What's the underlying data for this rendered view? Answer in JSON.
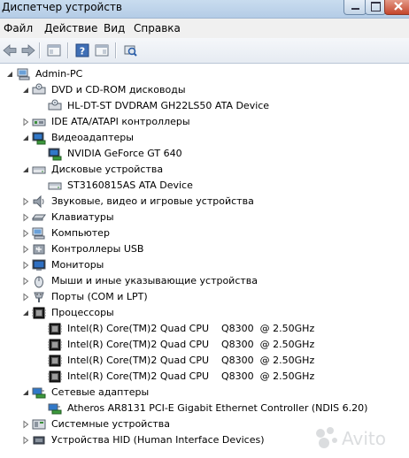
{
  "window": {
    "title": "Диспетчер устройств"
  },
  "menu": [
    "Файл",
    "Действие",
    "Вид",
    "Справка"
  ],
  "toolbar": {
    "buttons": [
      "back-arrow-icon",
      "forward-arrow-icon",
      "properties-view-icon",
      "help-icon",
      "console-icon",
      "scan-hardware-icon"
    ]
  },
  "tree": {
    "root": "Admin-PC",
    "items": [
      {
        "label": "DVD и CD-ROM дисководы",
        "icon": "dvd-drive-icon",
        "level": 1,
        "expander": "expanded"
      },
      {
        "label": "HL-DT-ST DVDRAM GH22LS50 ATA Device",
        "icon": "dvd-drive-icon",
        "level": 2,
        "expander": "none"
      },
      {
        "label": "IDE ATA/ATAPI контроллеры",
        "icon": "ide-controller-icon",
        "level": 1,
        "expander": "collapsed"
      },
      {
        "label": "Видеоадаптеры",
        "icon": "display-adapter-icon",
        "level": 1,
        "expander": "expanded"
      },
      {
        "label": "NVIDIA GeForce GT 640",
        "icon": "display-adapter-icon",
        "level": 2,
        "expander": "none"
      },
      {
        "label": "Дисковые устройства",
        "icon": "hard-disk-icon",
        "level": 1,
        "expander": "expanded"
      },
      {
        "label": "ST3160815AS ATA Device",
        "icon": "hard-disk-icon",
        "level": 2,
        "expander": "none"
      },
      {
        "label": "Звуковые, видео и игровые устройства",
        "icon": "sound-icon",
        "level": 1,
        "expander": "collapsed"
      },
      {
        "label": "Клавиатуры",
        "icon": "keyboard-icon",
        "level": 1,
        "expander": "collapsed"
      },
      {
        "label": "Компьютер",
        "icon": "computer-icon",
        "level": 1,
        "expander": "collapsed"
      },
      {
        "label": "Контроллеры USB",
        "icon": "usb-icon",
        "level": 1,
        "expander": "collapsed"
      },
      {
        "label": "Мониторы",
        "icon": "monitor-icon",
        "level": 1,
        "expander": "collapsed"
      },
      {
        "label": "Мыши и иные указывающие устройства",
        "icon": "mouse-icon",
        "level": 1,
        "expander": "collapsed"
      },
      {
        "label": "Порты (COM и LPT)",
        "icon": "port-icon",
        "level": 1,
        "expander": "collapsed"
      },
      {
        "label": "Процессоры",
        "icon": "processor-icon",
        "level": 1,
        "expander": "expanded"
      },
      {
        "label": "Intel(R) Core(TM)2 Quad CPU    Q8300  @ 2.50GHz",
        "icon": "processor-icon",
        "level": 2,
        "expander": "none"
      },
      {
        "label": "Intel(R) Core(TM)2 Quad CPU    Q8300  @ 2.50GHz",
        "icon": "processor-icon",
        "level": 2,
        "expander": "none"
      },
      {
        "label": "Intel(R) Core(TM)2 Quad CPU    Q8300  @ 2.50GHz",
        "icon": "processor-icon",
        "level": 2,
        "expander": "none"
      },
      {
        "label": "Intel(R) Core(TM)2 Quad CPU    Q8300  @ 2.50GHz",
        "icon": "processor-icon",
        "level": 2,
        "expander": "none"
      },
      {
        "label": "Сетевые адаптеры",
        "icon": "network-adapter-icon",
        "level": 1,
        "expander": "expanded"
      },
      {
        "label": "Atheros AR8131 PCI-E Gigabit Ethernet Controller (NDIS 6.20)",
        "icon": "network-adapter-icon",
        "level": 2,
        "expander": "none"
      },
      {
        "label": "Системные устройства",
        "icon": "system-devices-icon",
        "level": 1,
        "expander": "collapsed"
      },
      {
        "label": "Устройства HID (Human Interface Devices)",
        "icon": "hid-icon",
        "level": 1,
        "expander": "collapsed"
      }
    ]
  },
  "watermark": "Avito",
  "colors": {
    "titlebar": "#b4cce6",
    "menubar": "#f0f0f0",
    "selection_border": "#7a8aa0"
  }
}
